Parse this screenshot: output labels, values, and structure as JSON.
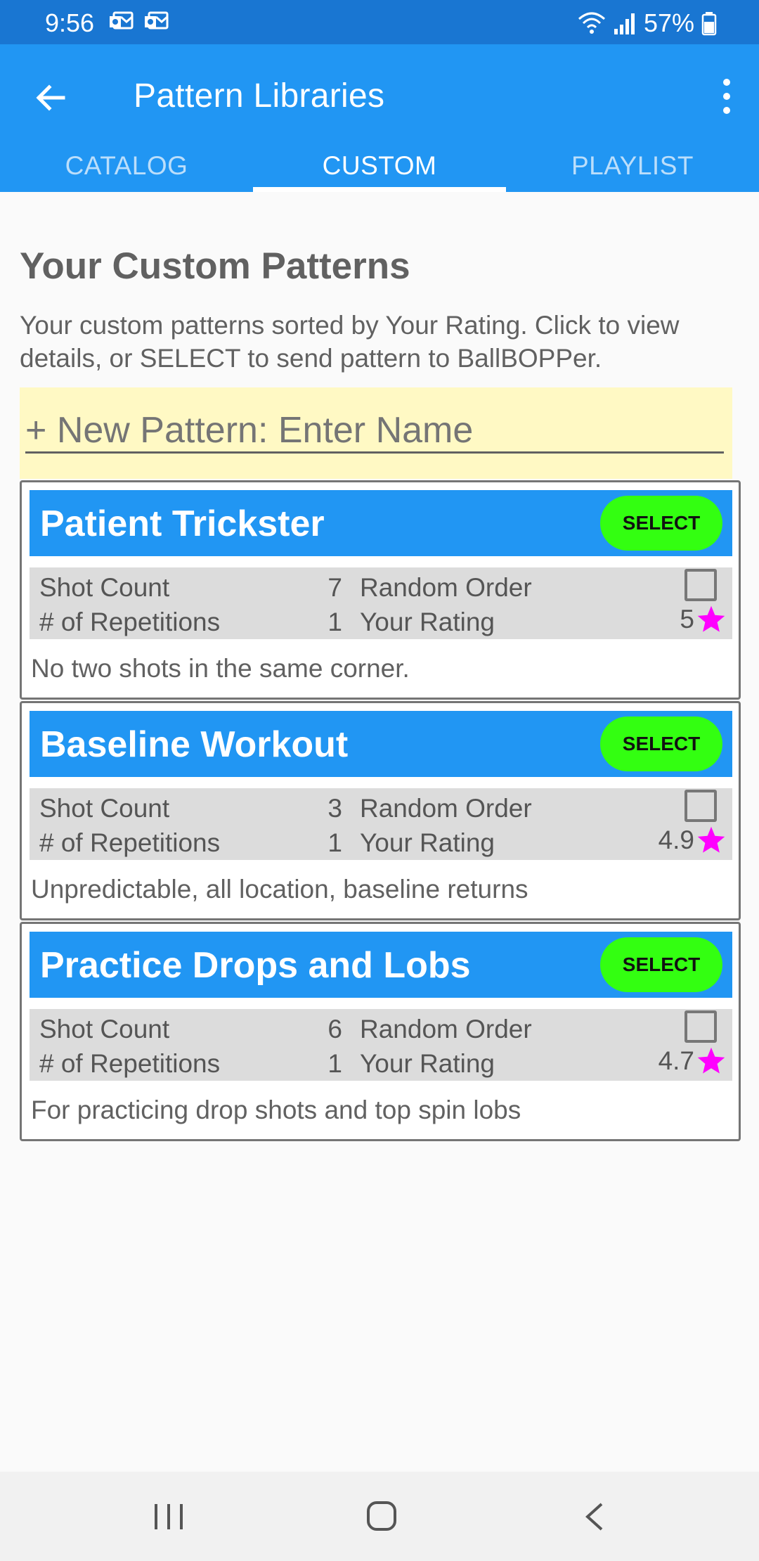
{
  "status_bar": {
    "time": "9:56",
    "battery": "57%"
  },
  "app_bar": {
    "title": "Pattern Libraries",
    "tabs": [
      {
        "label": "CATALOG",
        "active": false
      },
      {
        "label": "CUSTOM",
        "active": true
      },
      {
        "label": "PLAYLIST",
        "active": false
      }
    ]
  },
  "page": {
    "title": "Your Custom Patterns",
    "description": "Your custom patterns sorted by Your Rating. Click to view details, or SELECT to send  pattern to BallBOPPer.",
    "new_pattern_placeholder": "+ New Pattern: Enter Name"
  },
  "labels": {
    "shot_count": "Shot Count",
    "repetitions": "# of Repetitions",
    "random_order": "Random Order",
    "your_rating": "Your Rating",
    "select": "SELECT"
  },
  "patterns": [
    {
      "name": "Patient Trickster",
      "shot_count": "7",
      "repetitions": "1",
      "random_order": false,
      "rating": "5",
      "description": "No two shots in the same corner."
    },
    {
      "name": "Baseline Workout",
      "shot_count": "3",
      "repetitions": "1",
      "random_order": false,
      "rating": "4.9",
      "description": "Unpredictable, all location, baseline returns"
    },
    {
      "name": "Practice Drops and Lobs",
      "shot_count": "6",
      "repetitions": "1",
      "random_order": false,
      "rating": "4.7",
      "description": "For practicing drop shots and top spin lobs"
    }
  ],
  "colors": {
    "status_bar": "#1976d2",
    "app_bar": "#2196f3",
    "select_button": "#33ff11",
    "star": "#ff00ff",
    "new_pattern_bg": "#fff9c4"
  },
  "icons": {
    "back": "arrow-left-icon",
    "overflow": "more-vert-icon",
    "star": "star-icon"
  }
}
